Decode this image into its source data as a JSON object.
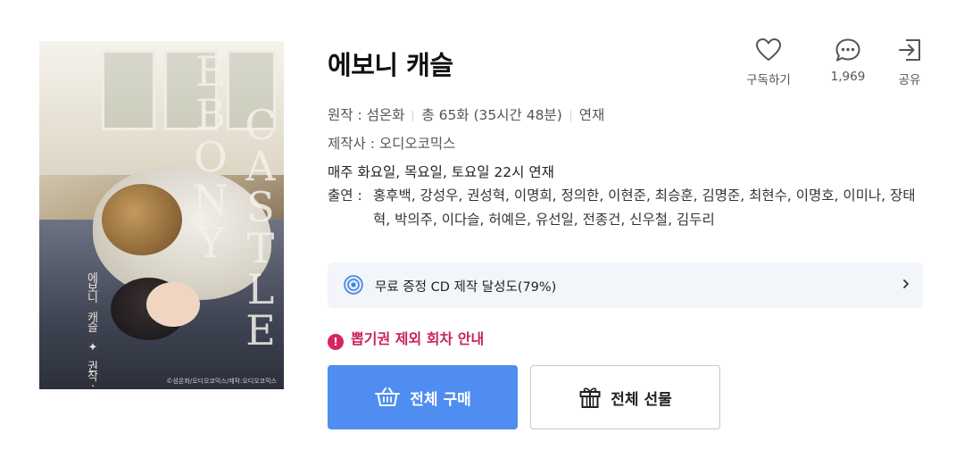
{
  "cover": {
    "title_letters_left": "EBONY",
    "title_letters_right": "CASTLE",
    "korean_vertical": "에보니 캐슬 ✦ 권작·섭온화",
    "fineprint": "©섬온화/오디오코믹스/제작:오디오코믹스"
  },
  "title": "에보니 캐슬",
  "actions": {
    "subscribe_label": "구독하기",
    "comments_count": "1,969",
    "share_label": "공유"
  },
  "info": {
    "author_label": "원작 : ",
    "author": "섬온화",
    "episodes": "총 65화 (35시간 48분)",
    "status": "연재",
    "producer_label": "제작사 : ",
    "producer": "오디오코믹스",
    "schedule": "매주 화요일, 목요일, 토요일 22시 연재",
    "cast_label": "출연 : ",
    "cast": "홍후백, 강성우, 권성혁, 이명희, 정의한, 이현준, 최승훈, 김명준, 최현수, 이명호, 이미나, 장태혁, 박의주, 이다슬, 허예은, 유선일, 전종건, 신우철, 김두리"
  },
  "cd_bar": {
    "text": "무료 증정 CD 제작 달성도(79%)"
  },
  "notice": {
    "text": "뽑기권 제외 회차 안내"
  },
  "buttons": {
    "buy_label": "전체 구매",
    "gift_label": "전체 선물"
  },
  "colors": {
    "accent_blue": "#4f8df0",
    "notice_pink": "#c8245a",
    "cd_bar_bg": "#f2f6fb"
  }
}
